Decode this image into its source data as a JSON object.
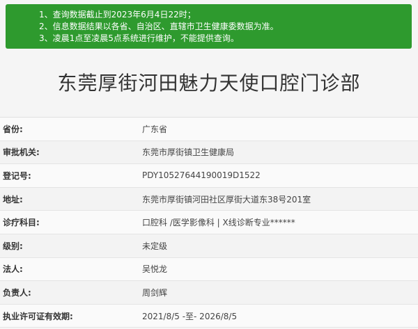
{
  "notice": {
    "lines": [
      "1、查询数据截止到2023年6月4日22时；",
      "2、信息数据结果以各省、自治区、直辖市卫生健康委数据为准。",
      "3、凌晨1点至凌晨5点系统进行维护，不能提供查询。"
    ]
  },
  "clinic": {
    "title": "东莞厚街河田魅力天使口腔门诊部"
  },
  "details": [
    {
      "label": "省份:",
      "value": "广东省"
    },
    {
      "label": "审批机关:",
      "value": "东莞市厚街镇卫生健康局"
    },
    {
      "label": "登记号:",
      "value": "PDY10527644190019D1522"
    },
    {
      "label": "地址:",
      "value": "东莞市厚街镇河田社区厚街大道东38号201室"
    },
    {
      "label": "诊疗科目:",
      "value": "口腔科 /医学影像科  |  X线诊断专业******"
    },
    {
      "label": "级别:",
      "value": "未定级"
    },
    {
      "label": "法人:",
      "value": "吴悦龙"
    },
    {
      "label": "负责人:",
      "value": "周剑辉"
    },
    {
      "label": "执业许可证有效期:",
      "value": "2021/8/5 -至- 2026/8/5"
    }
  ],
  "colors": {
    "notice_bg": "#2e9a2e",
    "page_bg": "#f5f5f5"
  }
}
